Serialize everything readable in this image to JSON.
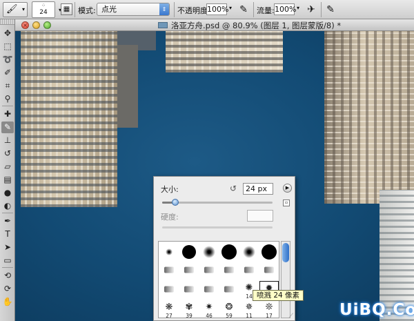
{
  "options_bar": {
    "brush_size": "24",
    "mode_label": "模式:",
    "mode_value": "点光",
    "opacity_label": "不透明度:",
    "opacity_value": "100%",
    "flow_label": "流量:",
    "flow_value": "100%"
  },
  "document": {
    "title": "洛亚方舟.psd @ 80.9% (图层 1, 图层蒙版/8) *"
  },
  "brush_panel": {
    "size_label": "大小:",
    "size_value": "24 px",
    "size_slider_fraction": 0.12,
    "hardness_label": "硬度:",
    "presets": [
      {
        "kind": "soft",
        "d": 10,
        "caption": ""
      },
      {
        "kind": "hard",
        "d": 20,
        "caption": ""
      },
      {
        "kind": "soft",
        "d": 18,
        "caption": ""
      },
      {
        "kind": "hard",
        "d": 22,
        "caption": ""
      },
      {
        "kind": "soft",
        "d": 18,
        "caption": ""
      },
      {
        "kind": "hard",
        "d": 22,
        "caption": ""
      },
      {
        "kind": "tip",
        "d": 0,
        "caption": ""
      },
      {
        "kind": "tip",
        "d": 0,
        "caption": ""
      },
      {
        "kind": "tip",
        "d": 0,
        "caption": ""
      },
      {
        "kind": "tip",
        "d": 0,
        "caption": ""
      },
      {
        "kind": "tip",
        "d": 0,
        "caption": ""
      },
      {
        "kind": "tip",
        "d": 0,
        "caption": ""
      },
      {
        "kind": "tip",
        "d": 0,
        "caption": ""
      },
      {
        "kind": "tip",
        "d": 0,
        "caption": ""
      },
      {
        "kind": "tip",
        "d": 0,
        "caption": ""
      },
      {
        "kind": "tip",
        "d": 0,
        "caption": ""
      },
      {
        "kind": "splat",
        "d": 0,
        "caption": "14"
      },
      {
        "kind": "splat",
        "d": 0,
        "caption": "24"
      },
      {
        "kind": "splat",
        "d": 0,
        "caption": "27"
      },
      {
        "kind": "splat",
        "d": 0,
        "caption": "39"
      },
      {
        "kind": "splat",
        "d": 0,
        "caption": "46"
      },
      {
        "kind": "splat",
        "d": 0,
        "caption": "59"
      },
      {
        "kind": "splat",
        "d": 0,
        "caption": "11"
      },
      {
        "kind": "splat",
        "d": 0,
        "caption": "17"
      }
    ],
    "selected_index": 17
  },
  "tooltip": "喷溅 24 像素",
  "watermark": "UiBQ.CoM",
  "tools": [
    "move-tool-icon",
    "marquee-tool-icon",
    "lasso-tool-icon",
    "quick-selection-tool-icon",
    "crop-tool-icon",
    "eyedropper-tool-icon",
    "healing-brush-tool-icon",
    "brush-tool-icon",
    "clone-stamp-tool-icon",
    "history-brush-tool-icon",
    "eraser-tool-icon",
    "gradient-tool-icon",
    "blur-tool-icon",
    "dodge-tool-icon",
    "pen-tool-icon",
    "type-tool-icon",
    "path-selection-tool-icon",
    "rectangle-tool-icon",
    "3d-rotate-tool-icon",
    "3d-orbit-tool-icon",
    "hand-tool-icon"
  ],
  "colors": {
    "canvas_blue": "#124a73",
    "tooltip_bg": "#ffffc8",
    "slider_accent": "#5b8fcb"
  }
}
